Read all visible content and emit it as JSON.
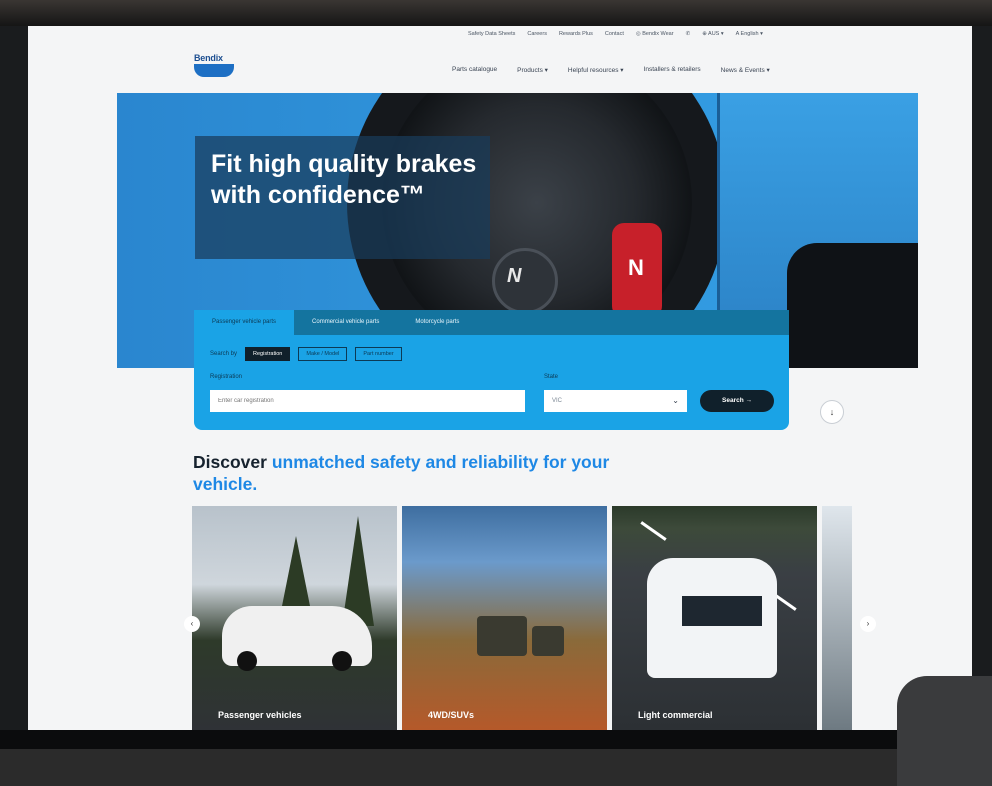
{
  "brand": {
    "logo_text": "Bendix"
  },
  "utility_nav": [
    "Safety Data Sheets",
    "Careers",
    "Rewards Plus",
    "Contact",
    "Bendix Wear",
    "AUS",
    "English"
  ],
  "main_nav": [
    "Parts catalogue",
    "Products",
    "Helpful resources",
    "Installers & retailers",
    "News & Events"
  ],
  "hero": {
    "headline": "Fit high quality brakes with confidence™"
  },
  "search": {
    "tabs": [
      "Passenger vehicle parts",
      "Commercial vehicle parts",
      "Motorcycle parts"
    ],
    "active_tab": "Passenger vehicle parts",
    "search_by_label": "Search by",
    "options": [
      "Registration",
      "Make / Model",
      "Part number"
    ],
    "active_option": "Registration",
    "registration_label": "Registration",
    "registration_placeholder": "Enter car registration",
    "state_label": "State",
    "state_value": "VIC",
    "button_label": "Search →"
  },
  "discover": {
    "prefix": "Discover",
    "accent": "unmatched safety and reliability for your vehicle."
  },
  "cards": [
    {
      "label": "Passenger vehicles"
    },
    {
      "label": "4WD/SUVs"
    },
    {
      "label": "Light commercial"
    }
  ],
  "colors": {
    "accent": "#1e88e5",
    "panel": "#1aa3e6",
    "dark": "#10202b"
  },
  "icons": {
    "scroll_down": "arrow-down-icon",
    "prev": "chevron-left-icon",
    "next": "chevron-right-icon"
  }
}
